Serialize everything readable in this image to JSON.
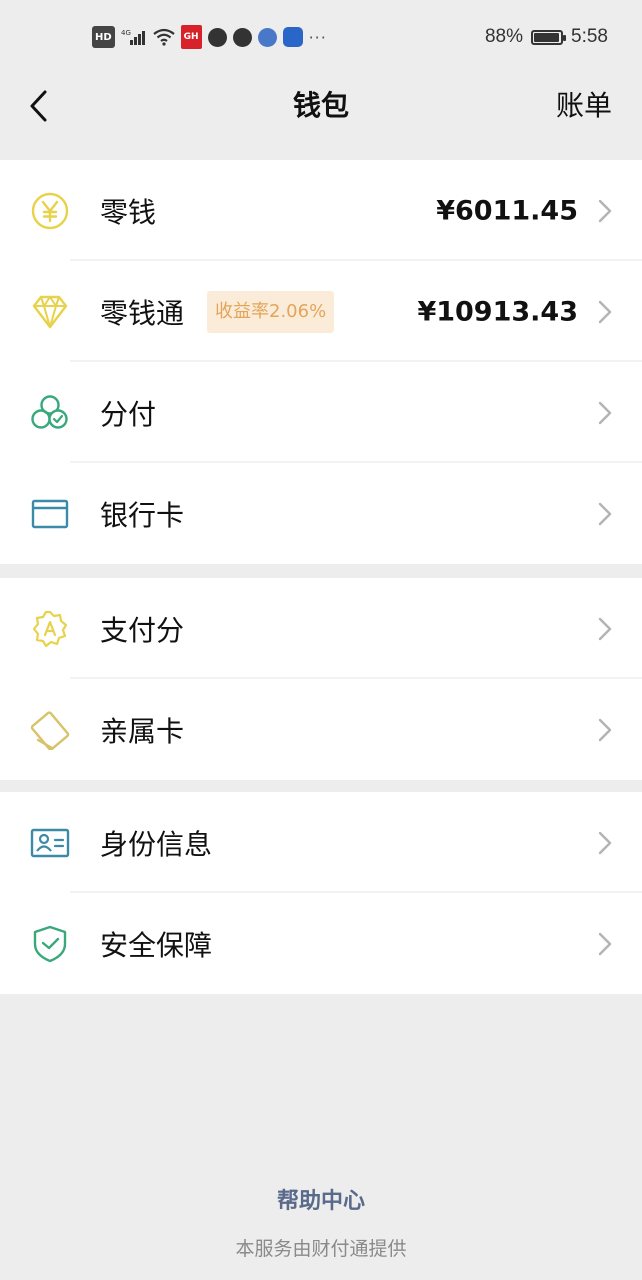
{
  "status_bar": {
    "hd": "HD",
    "network": "4G",
    "red_badge": "GH",
    "more": "···",
    "battery_percent": "88%",
    "battery_level": 0.88,
    "time": "5:58"
  },
  "nav": {
    "title": "钱包",
    "right_label": "账单"
  },
  "groups": [
    {
      "rows": [
        {
          "label": "零钱",
          "value": "¥6011.45",
          "icon": "coin-icon",
          "color": "#e8d24a"
        },
        {
          "label": "零钱通",
          "badge": "收益率2.06%",
          "value": "¥10913.43",
          "icon": "diamond-icon",
          "color": "#e8d24a"
        }
      ]
    },
    {
      "rows": [
        {
          "label": "分付",
          "icon": "clover-icon",
          "color": "#3aa87a"
        },
        {
          "label": "银行卡",
          "icon": "bank-card-icon",
          "color": "#3a8aa8"
        }
      ]
    },
    {
      "rows": [
        {
          "label": "支付分",
          "icon": "score-badge-icon",
          "color": "#e8d24a"
        },
        {
          "label": "亲属卡",
          "icon": "family-card-icon",
          "color": "#d8c26a"
        }
      ]
    },
    {
      "rows": [
        {
          "label": "身份信息",
          "icon": "id-card-icon",
          "color": "#3a8aa8"
        },
        {
          "label": "安全保障",
          "icon": "shield-check-icon",
          "color": "#3aa87a"
        }
      ]
    }
  ],
  "footer": {
    "help_link": "帮助中心",
    "provider_note": "本服务由财付通提供"
  }
}
